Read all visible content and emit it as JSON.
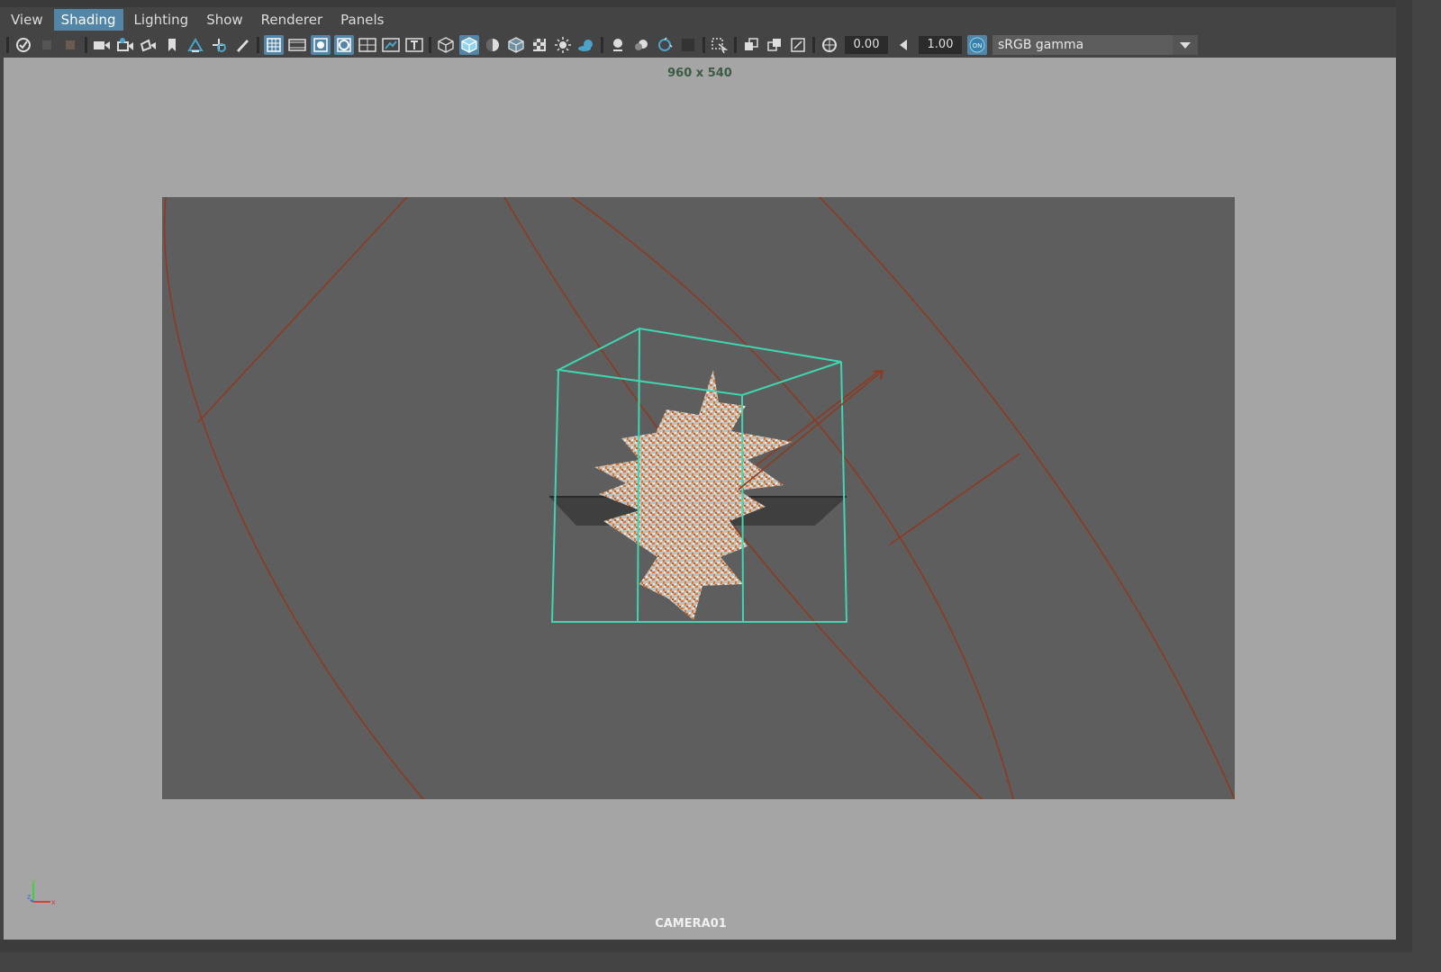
{
  "menu": {
    "items": [
      {
        "label": "View",
        "active": false
      },
      {
        "label": "Shading",
        "active": true
      },
      {
        "label": "Lighting",
        "active": false
      },
      {
        "label": "Show",
        "active": false
      },
      {
        "label": "Renderer",
        "active": false
      },
      {
        "label": "Panels",
        "active": false
      }
    ]
  },
  "toolbar": {
    "exposure_value": "0.00",
    "gamma_value": "1.00",
    "color_management_toggle": "ON",
    "view_transform": "sRGB gamma"
  },
  "viewport": {
    "resolution_label": "960 x 540",
    "camera_label": "CAMERA01",
    "axis_labels": {
      "y": "y",
      "z": "z",
      "x": "x"
    }
  },
  "colors": {
    "accent": "#5285a6",
    "selection_wireframe": "#3fd6b0",
    "curves": "#8c3a22",
    "particles": "#e0742a",
    "viewport_bg": "#a5a5a5",
    "gate_bg": "#5e5e5e"
  }
}
